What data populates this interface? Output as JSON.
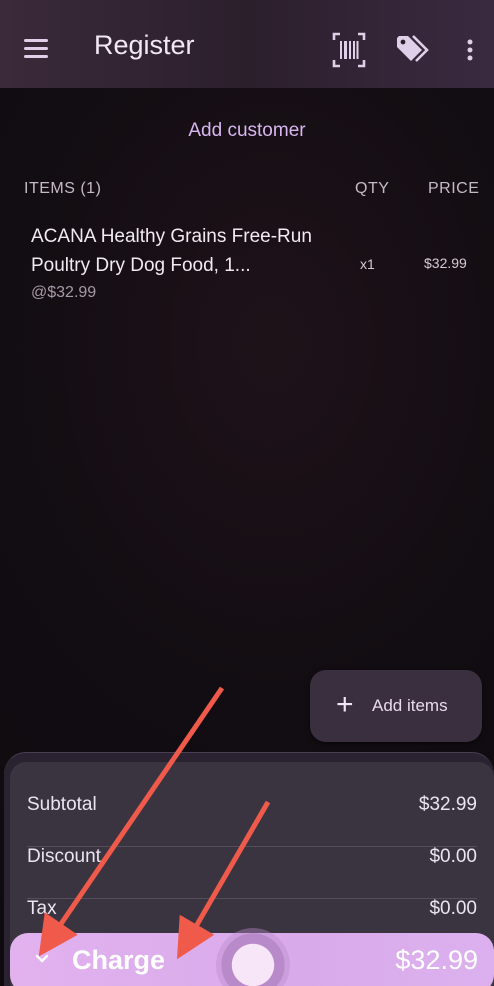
{
  "appbar": {
    "title": "Register",
    "menu_icon": "menu-icon",
    "barcode_icon": "barcode-icon",
    "tag_icon": "tag-icon",
    "more_icon": "more-vertical-icon"
  },
  "customer": {
    "add_label": "Add customer"
  },
  "table": {
    "headers": {
      "items": "ITEMS (1)",
      "qty": "QTY",
      "price": "PRICE"
    },
    "items": [
      {
        "name": "ACANA Healthy Grains Free-Run Poultry Dry Dog Food, 1...",
        "unit_price": "@$32.99",
        "qty": "x1",
        "price": "$32.99"
      }
    ]
  },
  "add_items": {
    "label": "Add items",
    "icon": "plus-icon"
  },
  "summary": {
    "rows": [
      {
        "label": "Subtotal",
        "value": "$32.99"
      },
      {
        "label": "Discount",
        "value": "$0.00"
      },
      {
        "label": "Tax",
        "value": "$0.00"
      }
    ]
  },
  "charge": {
    "label": "Charge",
    "amount": "$32.99",
    "icon": "chevron-down-icon"
  },
  "colors": {
    "accent": "#d9aaea",
    "appbar": "#2c1f2c",
    "annotation_arrow": "#ef5a4a"
  }
}
